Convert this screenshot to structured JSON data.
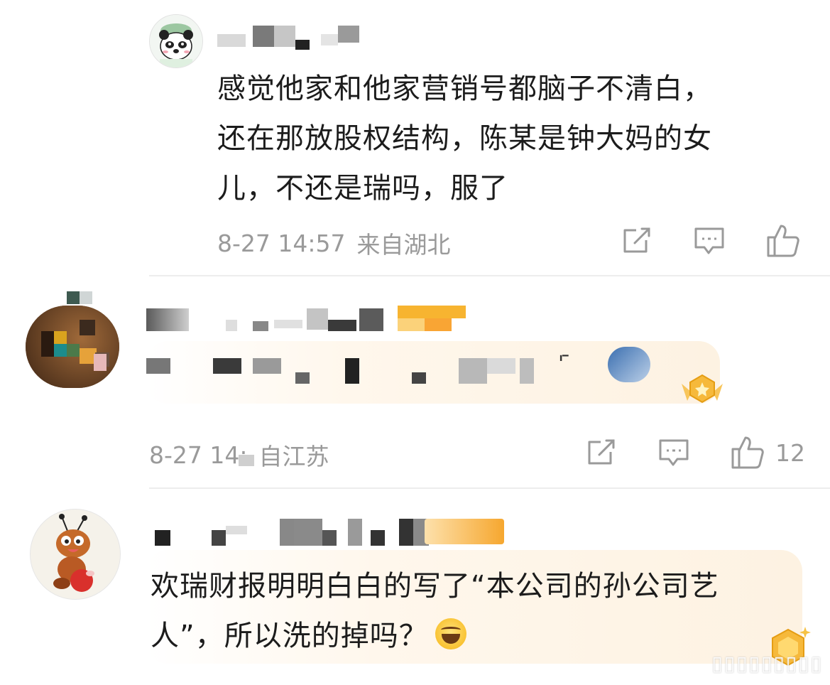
{
  "comments": [
    {
      "text_line1": "感觉他家和他家营销号都脑子不清白，",
      "text_line2": "还在那放股权结构，陈某是钟大妈的女",
      "text_line3": "儿，不还是瑞吗，服了",
      "date": "8-27 14:57",
      "location": "来自湖北",
      "like_count": ""
    },
    {
      "date": "8-27 14:",
      "location": "自江苏",
      "like_count": "12"
    },
    {
      "text_line1": "欢瑞财报明明白白的写了“本公司的孙公司艺",
      "text_line2": "人”，所以洗的掉吗？",
      "emoji": "laughing-emoji",
      "date": "",
      "location": "",
      "like_count": ""
    }
  ],
  "icons": {
    "share": "share-icon",
    "comment": "comment-icon",
    "like": "thumbs-up-icon"
  },
  "colors": {
    "meta_gray": "#9a9a9a",
    "divider": "#ededed",
    "fan_band": "#fdf2e2",
    "gold_badge": "#f6b93b"
  }
}
